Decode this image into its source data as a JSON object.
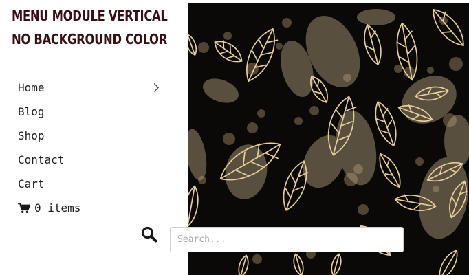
{
  "module": {
    "title": "MENU MODULE VERTICAL NO BACKGROUND COLOR"
  },
  "menu": {
    "items": [
      {
        "label": "Home",
        "has_submenu": true
      },
      {
        "label": "Blog"
      },
      {
        "label": "Shop"
      },
      {
        "label": "Contact"
      },
      {
        "label": "Cart"
      }
    ],
    "cart_summary": {
      "icon": "shopping-cart-icon",
      "text": "0 items"
    }
  },
  "search": {
    "icon": "search-icon",
    "placeholder": "Search..."
  },
  "theme": {
    "title_color": "#3a0f12",
    "hero_background": "#0a0907",
    "leaf_outline_color": "#e8cf9a"
  }
}
